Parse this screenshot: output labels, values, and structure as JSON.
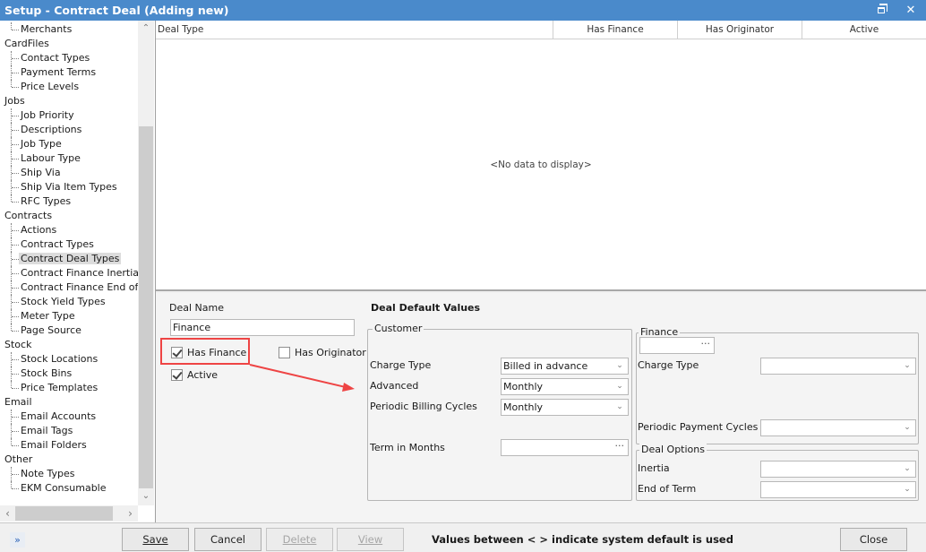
{
  "window": {
    "title": "Setup - Contract Deal (Adding new)",
    "restore_icon": "restore-icon",
    "close_icon": "close-icon",
    "close_glyph": "✕"
  },
  "sidebar": {
    "tree": [
      {
        "type": "child",
        "label": "Merchants",
        "last": true
      },
      {
        "type": "group",
        "label": "CardFiles"
      },
      {
        "type": "child",
        "label": "Contact Types"
      },
      {
        "type": "child",
        "label": "Payment Terms"
      },
      {
        "type": "child",
        "label": "Price Levels",
        "last": true
      },
      {
        "type": "group",
        "label": "Jobs"
      },
      {
        "type": "child",
        "label": "Job Priority"
      },
      {
        "type": "child",
        "label": "Descriptions"
      },
      {
        "type": "child",
        "label": "Job Type"
      },
      {
        "type": "child",
        "label": "Labour Type"
      },
      {
        "type": "child",
        "label": "Ship Via"
      },
      {
        "type": "child",
        "label": "Ship Via Item Types"
      },
      {
        "type": "child",
        "label": "RFC Types",
        "last": true
      },
      {
        "type": "group",
        "label": "Contracts"
      },
      {
        "type": "child",
        "label": "Actions"
      },
      {
        "type": "child",
        "label": "Contract Types"
      },
      {
        "type": "child",
        "label": "Contract Deal Types",
        "selected": true
      },
      {
        "type": "child",
        "label": "Contract Finance Inertia"
      },
      {
        "type": "child",
        "label": "Contract Finance End of Te"
      },
      {
        "type": "child",
        "label": "Stock Yield Types"
      },
      {
        "type": "child",
        "label": "Meter Type"
      },
      {
        "type": "child",
        "label": "Page Source",
        "last": true
      },
      {
        "type": "group",
        "label": "Stock"
      },
      {
        "type": "child",
        "label": "Stock Locations"
      },
      {
        "type": "child",
        "label": "Stock Bins"
      },
      {
        "type": "child",
        "label": "Price Templates",
        "last": true
      },
      {
        "type": "group",
        "label": "Email"
      },
      {
        "type": "child",
        "label": "Email Accounts"
      },
      {
        "type": "child",
        "label": "Email Tags"
      },
      {
        "type": "child",
        "label": "Email Folders",
        "last": true
      },
      {
        "type": "group",
        "label": "Other"
      },
      {
        "type": "child",
        "label": "Note Types"
      },
      {
        "type": "child",
        "label": "EKM Consumable",
        "last": true
      }
    ],
    "scroll_up": "⌃",
    "scroll_down": "⌄",
    "scroll_left": "‹",
    "scroll_right": "›"
  },
  "grid": {
    "columns": [
      "Deal Type",
      "Has Finance",
      "Has Originator",
      "Active"
    ],
    "rows": [],
    "empty_text": "<No data to display>"
  },
  "detail": {
    "deal_name_label": "Deal Name",
    "deal_name_value": "Finance",
    "has_finance_label": "Has Finance",
    "has_finance_checked": true,
    "has_originator_label": "Has Originator",
    "has_originator_checked": false,
    "active_label": "Active",
    "active_checked": true,
    "defaults_heading": "Deal Default Values",
    "customer": {
      "legend": "Customer",
      "charge_type_label": "Charge Type",
      "charge_type_value": "Billed in advance",
      "advanced_label": "Advanced",
      "advanced_value": "Monthly",
      "billing_cycles_label": "Periodic Billing Cycles",
      "billing_cycles_value": "Monthly",
      "term_label": "Term in Months",
      "term_value": ""
    },
    "finance": {
      "legend": "Finance",
      "lookup_value": "",
      "charge_type_label": "Charge Type",
      "charge_type_value": "",
      "payment_cycles_label": "Periodic Payment Cycles",
      "payment_cycles_value": ""
    },
    "deal_options": {
      "legend": "Deal Options",
      "inertia_label": "Inertia",
      "inertia_value": "",
      "end_of_term_label": "End of Term",
      "end_of_term_value": ""
    },
    "ellipsis": "···",
    "chevron": "⌄",
    "annotation_color": "#ee4444"
  },
  "footer": {
    "expand_glyph": "»",
    "save_label": "Save",
    "cancel_label": "Cancel",
    "delete_label": "Delete",
    "view_label": "View",
    "note": "Values between < > indicate system default is used",
    "close_label": "Close"
  }
}
